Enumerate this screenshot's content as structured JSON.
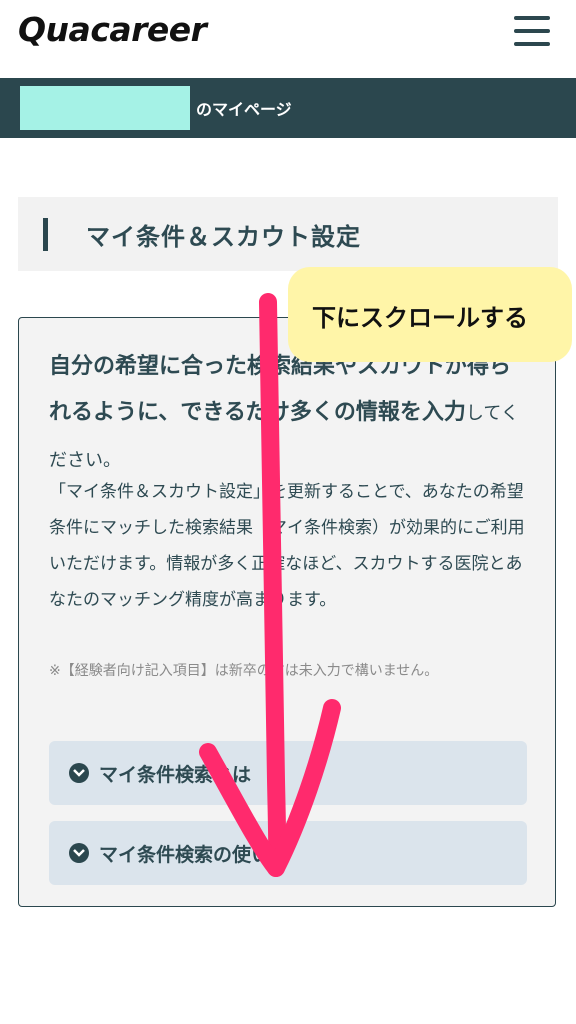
{
  "header": {
    "logo": "Quacareer",
    "menu_icon": "hamburger-icon"
  },
  "userbar": {
    "label": "のマイページ"
  },
  "section": {
    "title": "マイ条件＆スカウト設定"
  },
  "card": {
    "lead_bold": "自分の希望に合った検索結果やスカウトが得られるように、できるだけ多くの情報を入力",
    "lead_tail": "してください。",
    "body": "「マイ条件＆スカウト設定」を更新することで、あなたの希望条件にマッチした検索結果（マイ条件検索）が効果的にご利用いただけます。情報が多く正確なほど、スカウトする医院とあなたのマッチング精度が高まります。",
    "note": "※【経験者向け記入項目】は新卒の方は未入力で構いません。",
    "accordions": [
      {
        "label": "マイ条件検索とは"
      },
      {
        "label": "マイ条件検索の使い方"
      }
    ]
  },
  "callout": {
    "text": "下にスクロールする"
  },
  "colors": {
    "primary": "#2b474e",
    "mask": "#a5f2e6",
    "callout": "#fff5a8",
    "arrow": "#ff2a6d",
    "accordion": "#dbe4ec"
  }
}
